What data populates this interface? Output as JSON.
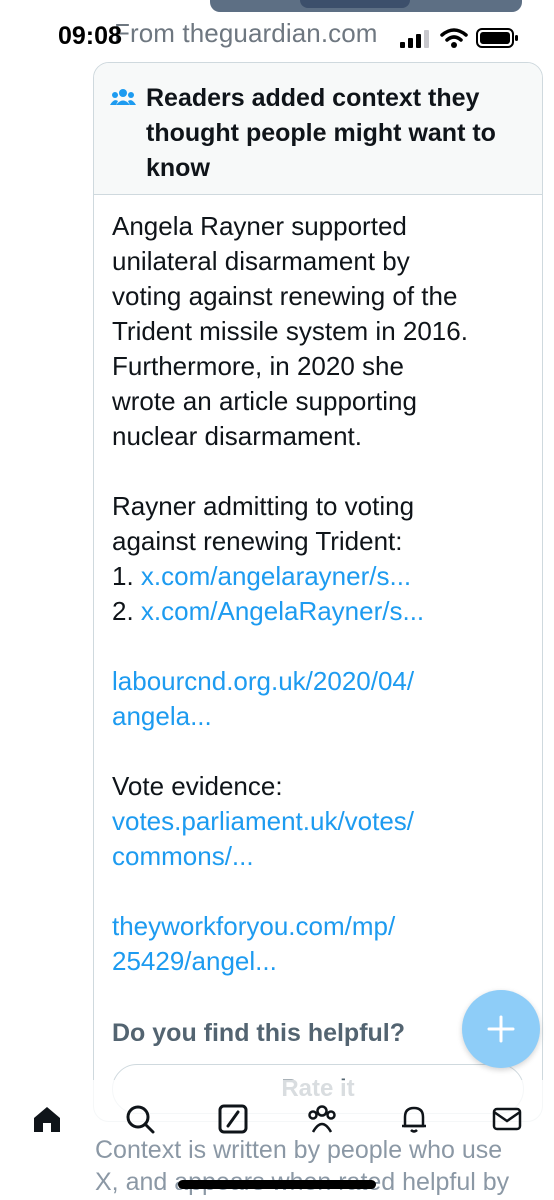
{
  "status_bar": {
    "time": "09:08",
    "icons": [
      "cellular-signal-icon",
      "wifi-icon",
      "battery-icon"
    ]
  },
  "source_line": "From theguardian.com",
  "community_note": {
    "header_title": "Readers added context they thought people might want to know",
    "header_icon": "people-icon",
    "paragraph_1": [
      "Angela Rayner supported",
      "unilateral disarmament by",
      "voting against renewing of the",
      "Trident missile system in 2016.",
      "Furthermore, in 2020 she",
      "wrote an article supporting",
      "nuclear disarmament."
    ],
    "paragraph_2_lines": [
      "Rayner admitting to voting",
      "against renewing Trident:"
    ],
    "list": [
      {
        "number": "1.",
        "link": "x.com/angelarayner/s..."
      },
      {
        "number": "2.",
        "link": "x.com/AngelaRayner/s..."
      }
    ],
    "link_3_lines": [
      "labourcnd.org.uk/2020/04/",
      "angela..."
    ],
    "vote_evidence_label": "Vote evidence:",
    "link_4_lines": [
      "votes.parliament.uk/votes/",
      "commons/..."
    ],
    "link_5_lines": [
      "theyworkforyou.com/mp/",
      "25429/angel..."
    ],
    "helpful_question": "Do you find this helpful?",
    "rate_button": "Rate it"
  },
  "fab": {
    "icon": "plus-icon"
  },
  "bottom_nav": {
    "items": [
      "home-icon",
      "search-icon",
      "grok-icon",
      "communities-icon",
      "notifications-icon",
      "messages-icon"
    ]
  },
  "context_footer": {
    "line_1": "Context is written by people who use",
    "line_2": "X, and appears when rated helpful by"
  },
  "colors": {
    "link": "#1d9bf0",
    "fab": "#8ecdf8",
    "header_bg": "#f7f9f9",
    "muted_text": "#536471"
  }
}
